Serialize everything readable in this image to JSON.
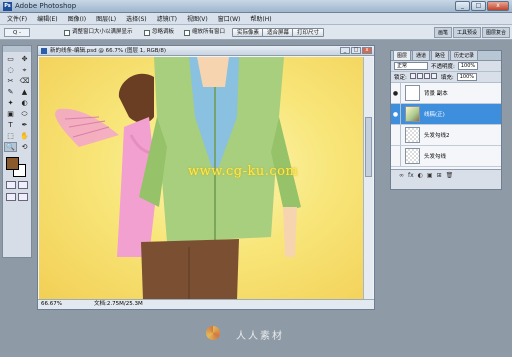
{
  "app": {
    "title": "Adobe Photoshop",
    "window_buttons": [
      "_",
      "□",
      "x"
    ]
  },
  "menu": [
    "文件(F)",
    "编辑(E)",
    "图像(I)",
    "图层(L)",
    "选择(S)",
    "滤镜(T)",
    "视图(V)",
    "窗口(W)",
    "帮助(H)"
  ],
  "options": {
    "tool_indicator": "Q -",
    "resize_windows": "调整窗口大小以满屏显示",
    "ignore_palettes": "忽略调板",
    "zoom_all_windows": "缩放所有窗口",
    "actual_pixels": "实际像素",
    "fit_screen": "适合屏幕",
    "print_size": "打印尺寸",
    "right_tabs": [
      "画笔",
      "工具预设",
      "图层复合"
    ]
  },
  "toolbox": {
    "tools": [
      "▭",
      "✥",
      "◌",
      "⌖",
      "✂",
      "⌫",
      "✎",
      "▲",
      "✦",
      "◐",
      "▣",
      "⬭",
      "T",
      "✒",
      "⬚",
      "✋",
      "🔍",
      "⟲"
    ],
    "fg_color": "#8a5a2c",
    "bg_color": "#ffffff"
  },
  "document": {
    "title": "新的线条-编辑.psd @ 66.7% (图层 1, RGB/8)",
    "zoom": "66.67%",
    "doc_size": "文档:2.75M/25.3M",
    "watermark_url": "www.cg-ku.com"
  },
  "layers_panel": {
    "tabs": [
      "图层",
      "通道",
      "路径",
      "历史记录"
    ],
    "blend_mode": "正常",
    "opacity_label": "不透明度:",
    "opacity_value": "100%",
    "lock_label": "锁定:",
    "fill_label": "填充:",
    "fill_value": "100%",
    "layers": [
      {
        "name": "背景 副本",
        "selected": false
      },
      {
        "name": "线稿(正)",
        "selected": true
      },
      {
        "name": "头发勾线2",
        "selected": false
      },
      {
        "name": "头发勾线",
        "selected": false
      }
    ],
    "footer_icons": [
      "∞",
      "fx",
      "◐",
      "▣",
      "⊞",
      "🗑"
    ]
  },
  "watermark": {
    "text": "人人素材"
  },
  "colors": {
    "selected_layer": "#3e8ede",
    "canvas_yellow": "#f8e67a",
    "jacket_green": "#a8cf7e"
  }
}
